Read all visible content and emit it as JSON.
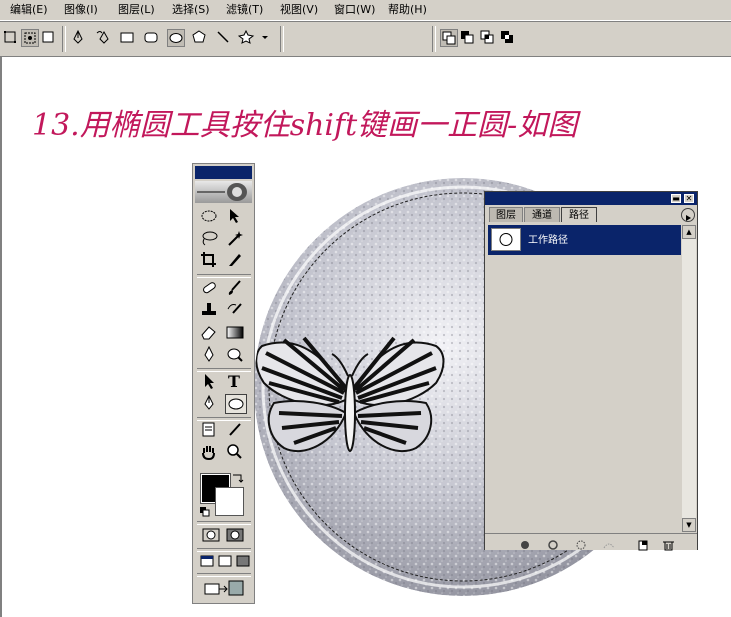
{
  "menu": {
    "items": [
      {
        "label": "编辑(E)"
      },
      {
        "label": "图像(I)"
      },
      {
        "label": "图层(L)"
      },
      {
        "label": "选择(S)"
      },
      {
        "label": "滤镜(T)"
      },
      {
        "label": "视图(V)"
      },
      {
        "label": "窗口(W)"
      },
      {
        "label": "帮助(H)"
      }
    ]
  },
  "caption": "13.用椭圆工具按住shift键画一正圆-如图",
  "toolbox": {
    "foreground_color": "#000000",
    "background_color": "#ffffff"
  },
  "paths_panel": {
    "tabs": [
      {
        "label": "图层"
      },
      {
        "label": "通道"
      },
      {
        "label": "路径"
      }
    ],
    "active_tab": "路径",
    "items": [
      {
        "label": "工作路径"
      }
    ]
  },
  "colors": {
    "caption": "#c2185b",
    "selection_blue": "#0a246a",
    "chrome": "#d4d0c8"
  }
}
